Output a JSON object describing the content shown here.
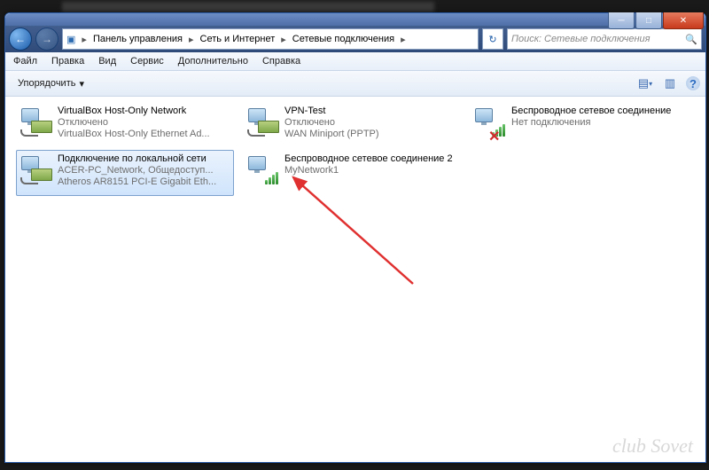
{
  "window_controls": {
    "minimize": "─",
    "maximize": "□",
    "close": "✕"
  },
  "nav": {
    "back": "←",
    "forward": "→"
  },
  "breadcrumbs": {
    "sep": "▸",
    "items": [
      "Панель управления",
      "Сеть и Интернет",
      "Сетевые подключения"
    ]
  },
  "refresh_glyph": "↻",
  "search": {
    "placeholder": "Поиск: Сетевые подключения",
    "icon": "🔍"
  },
  "menu": {
    "file": "Файл",
    "edit": "Правка",
    "view": "Вид",
    "service": "Сервис",
    "extra": "Дополнительно",
    "help": "Справка"
  },
  "toolbar": {
    "organize": "Упорядочить",
    "chevron": "▾",
    "view_icon": "▤",
    "pane_icon": "▥",
    "help_icon": "?"
  },
  "connections": [
    {
      "name": "VirtualBox Host-Only Network",
      "status": "Отключено",
      "device": "VirtualBox Host-Only Ethernet Ad...",
      "wifi": false,
      "disabled": false,
      "selected": false
    },
    {
      "name": "VPN-Test",
      "status": "Отключено",
      "device": "WAN Miniport (PPTP)",
      "wifi": false,
      "disabled": false,
      "selected": false
    },
    {
      "name": "Беспроводное сетевое соединение",
      "status": "Нет подключения",
      "device": "",
      "wifi": true,
      "disabled": true,
      "selected": false
    },
    {
      "name": "Подключение по локальной сети",
      "status": "ACER-PC_Network, Общедоступ...",
      "device": "Atheros AR8151 PCI-E Gigabit Eth...",
      "wifi": false,
      "disabled": false,
      "selected": true
    },
    {
      "name": "Беспроводное сетевое соединение 2",
      "status": "MyNetwork1",
      "device": "",
      "wifi": true,
      "disabled": false,
      "selected": false
    }
  ],
  "watermark": "club\nSovet"
}
